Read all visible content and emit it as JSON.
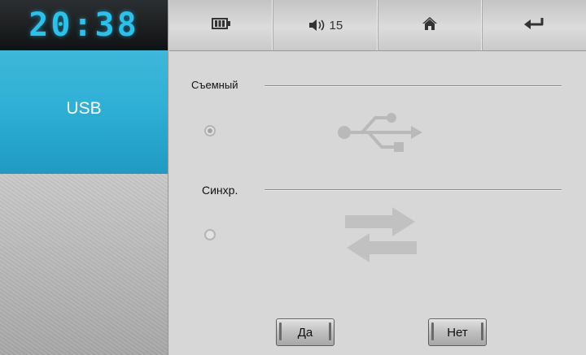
{
  "clock": {
    "time": "20:38"
  },
  "sidebar": {
    "active_tab": "USB"
  },
  "toolbar": {
    "battery_icon": "battery-icon",
    "volume_icon": "volume-icon",
    "volume_level": "15",
    "home_icon": "home-icon",
    "back_icon": "back-arrow-icon"
  },
  "options": [
    {
      "label": "Съемный",
      "selected": true,
      "icon": "usb-symbol-icon"
    },
    {
      "label": "Синхр.",
      "selected": false,
      "icon": "sync-arrows-icon"
    }
  ],
  "dialog": {
    "yes_label": "Да",
    "no_label": "Нет"
  },
  "colors": {
    "accent": "#2fb0d6",
    "clock_digits": "#27c3ee",
    "background": "#d7d7d7"
  }
}
